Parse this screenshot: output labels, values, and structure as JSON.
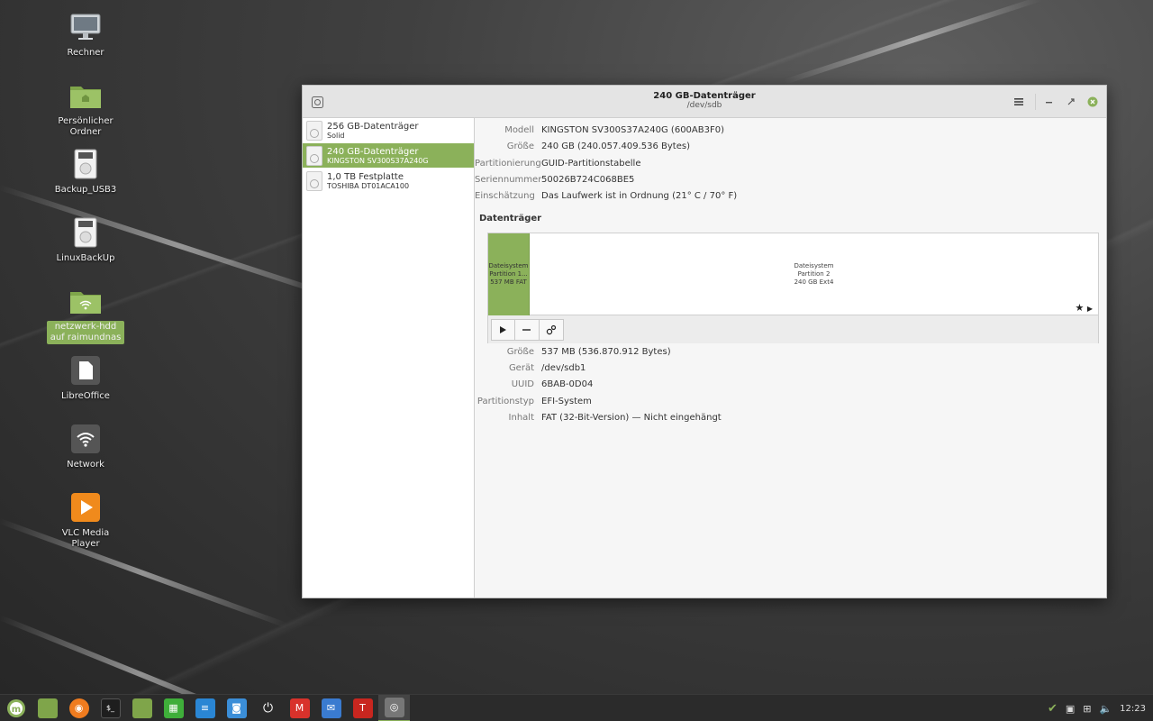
{
  "desktop": {
    "icons": [
      {
        "label": "Rechner",
        "icon": "computer-icon"
      },
      {
        "label": "Persönlicher Ordner",
        "icon": "home-folder-icon"
      },
      {
        "label": "Backup_USB3",
        "icon": "drive-icon"
      },
      {
        "label": "LinuxBackUp",
        "icon": "drive-icon"
      },
      {
        "label": "netzwerk-hdd auf raimundnas",
        "icon": "network-folder-icon"
      },
      {
        "label": "LibreOffice",
        "icon": "document-icon"
      },
      {
        "label": "Network",
        "icon": "wifi-icon"
      },
      {
        "label": "VLC Media Player",
        "icon": "vlc-icon"
      }
    ]
  },
  "window": {
    "title": "240 GB-Datenträger",
    "subtitle": "/dev/sdb"
  },
  "drives": [
    {
      "name": "256 GB-Datenträger",
      "sub": "Solid"
    },
    {
      "name": "240 GB-Datenträger",
      "sub": "KINGSTON SV300S37A240G"
    },
    {
      "name": "1,0 TB Festplatte",
      "sub": "TOSHIBA DT01ACA100"
    }
  ],
  "disk": {
    "model_label": "Modell",
    "model": "KINGSTON SV300S37A240G (600AB3F0)",
    "size_label": "Größe",
    "size": "240 GB (240.057.409.536 Bytes)",
    "partitioning_label": "Partitionierung",
    "partitioning": "GUID-Partitionstabelle",
    "serial_label": "Seriennummer",
    "serial": "50026B724C068BE5",
    "assessment_label": "Einschätzung",
    "assessment": "Das Laufwerk ist in Ordnung (21° C / 70° F)"
  },
  "volumes": {
    "heading": "Datenträger",
    "p1": {
      "line1": "Dateisystem",
      "line2": "Partition 1...",
      "line3": "537 MB FAT"
    },
    "p2": {
      "line1": "Dateisystem",
      "line2": "Partition 2",
      "line3": "240 GB Ext4"
    }
  },
  "partition": {
    "size_label": "Größe",
    "size": "537 MB (536.870.912 Bytes)",
    "device_label": "Gerät",
    "device": "/dev/sdb1",
    "uuid_label": "UUID",
    "uuid": "6BAB-0D04",
    "type_label": "Partitionstyp",
    "type": "EFI-System",
    "content_label": "Inhalt",
    "content": "FAT (32-Bit-Version) — Nicht eingehängt"
  },
  "taskbar": {
    "clock": "12:23"
  },
  "colors": {
    "accent": "#8bb15a"
  }
}
